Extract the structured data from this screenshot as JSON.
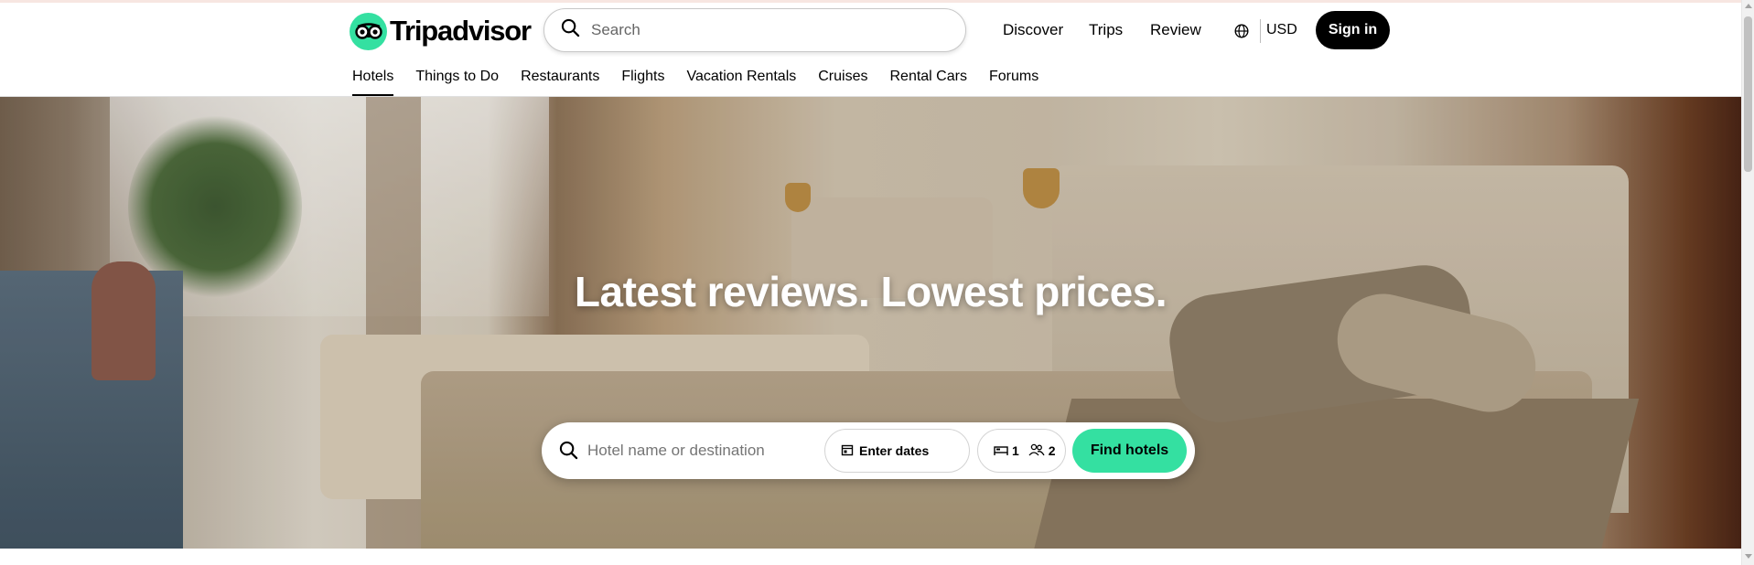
{
  "brand": {
    "name": "Tripadvisor",
    "accent_color": "#34e0a1"
  },
  "header": {
    "search": {
      "placeholder": "Search"
    },
    "nav": {
      "discover": "Discover",
      "trips": "Trips",
      "review": "Review"
    },
    "currency": "USD",
    "sign_in": "Sign in"
  },
  "tabs": [
    {
      "label": "Hotels",
      "active": true
    },
    {
      "label": "Things to Do"
    },
    {
      "label": "Restaurants"
    },
    {
      "label": "Flights"
    },
    {
      "label": "Vacation Rentals"
    },
    {
      "label": "Cruises"
    },
    {
      "label": "Rental Cars"
    },
    {
      "label": "Forums"
    }
  ],
  "hero": {
    "title": "Latest reviews. Lowest prices.",
    "search": {
      "placeholder": "Hotel name or destination",
      "dates_label": "Enter dates",
      "rooms": "1",
      "guests": "2",
      "submit_label": "Find hotels"
    }
  },
  "icons": [
    "tripadvisor-owl-icon",
    "search-icon",
    "globe-icon",
    "calendar-icon",
    "bed-icon",
    "guests-icon"
  ]
}
